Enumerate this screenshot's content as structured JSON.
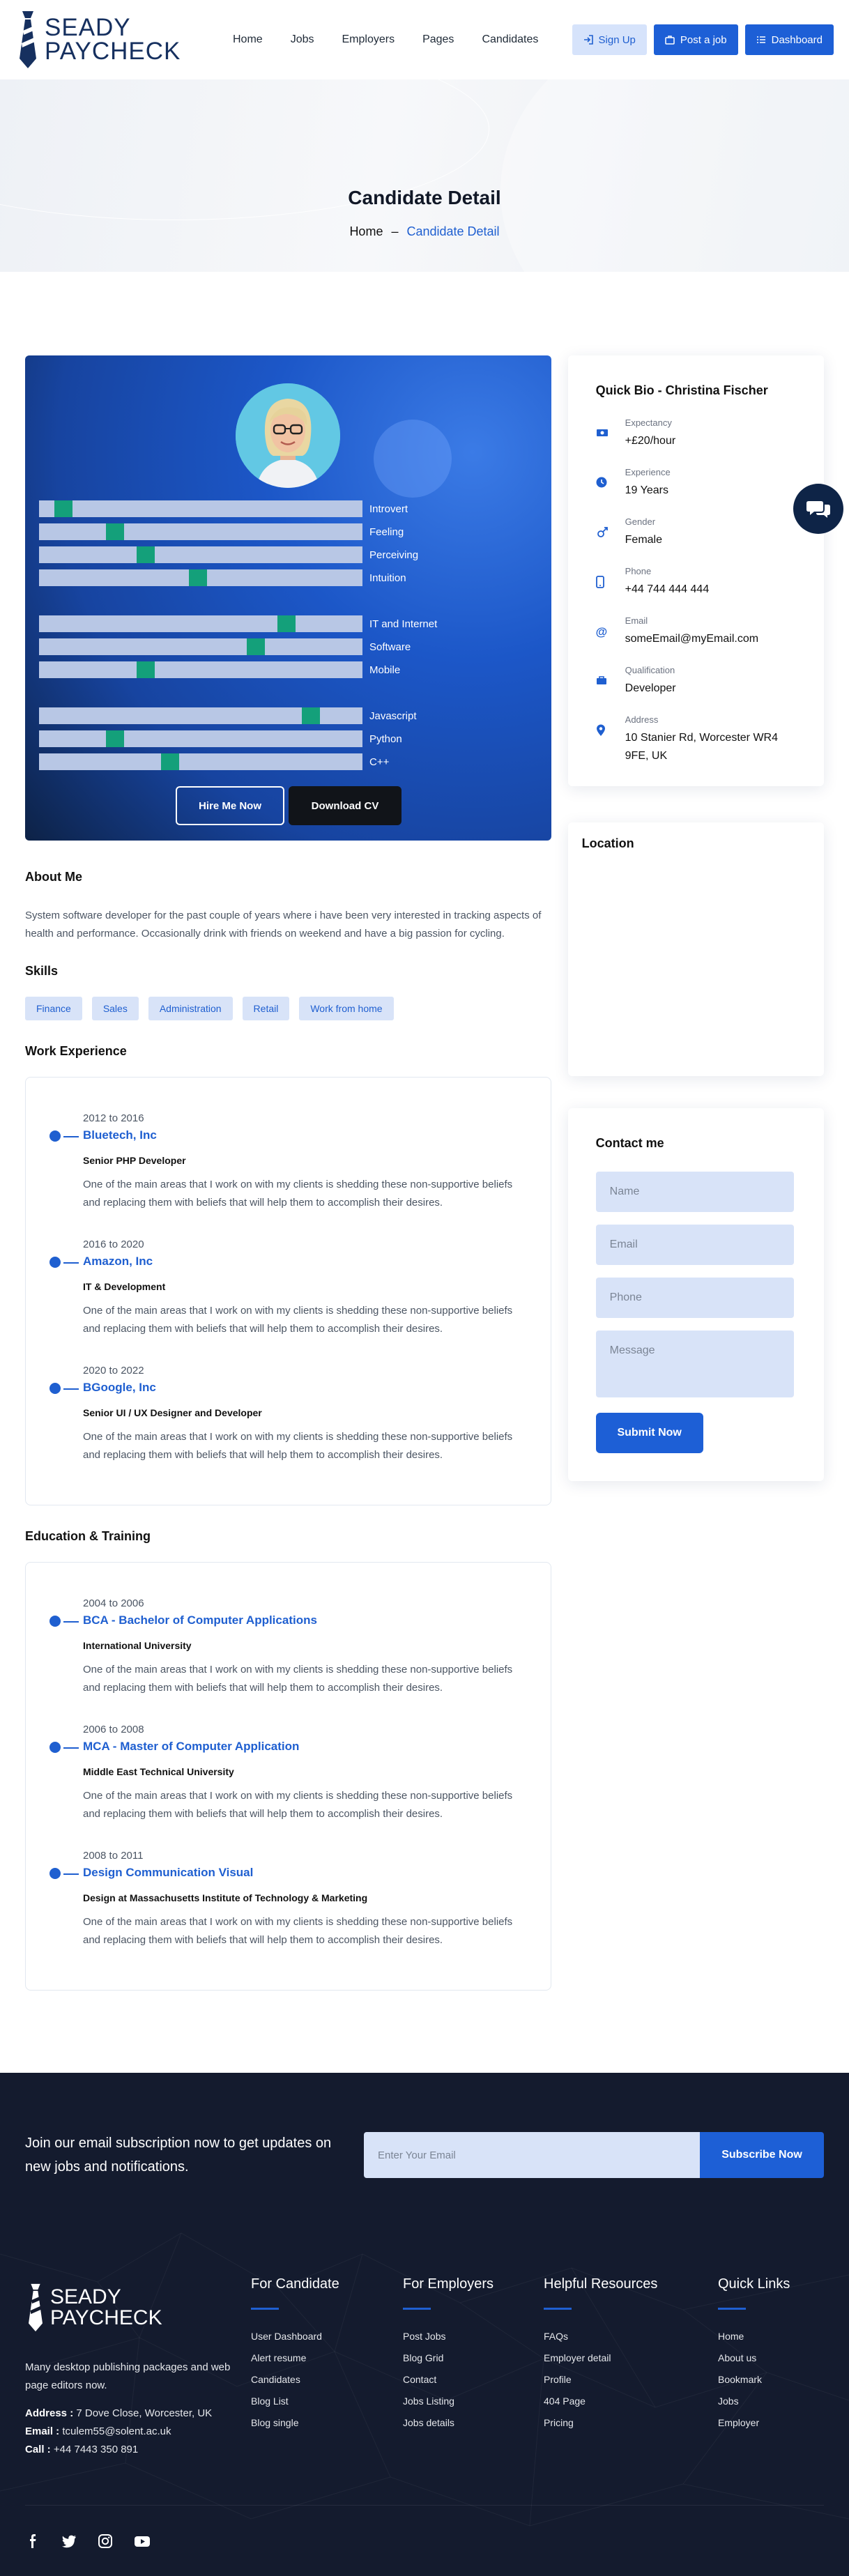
{
  "brand": {
    "logo_line1": "SEADY",
    "logo_line2": "PAYCHECK"
  },
  "nav": {
    "items": [
      "Home",
      "Jobs",
      "Employers",
      "Pages",
      "Candidates"
    ]
  },
  "header_actions": {
    "signup": "Sign Up",
    "post_job": "Post a job",
    "dashboard": "Dashboard"
  },
  "hero": {
    "title": "Candidate Detail",
    "crumb_home": "Home",
    "crumb_sep": "–",
    "crumb_current": "Candidate Detail"
  },
  "profile": {
    "bars": [
      {
        "label": "Introvert",
        "level": 0.05
      },
      {
        "label": "Feeling",
        "level": 0.22
      },
      {
        "label": "Perceiving",
        "level": 0.32
      },
      {
        "label": "Intuition",
        "level": 0.49
      },
      {
        "label": "IT and Internet",
        "level": 0.78
      },
      {
        "label": "Software",
        "level": 0.68
      },
      {
        "label": "Mobile",
        "level": 0.32
      },
      {
        "label": "Javascript",
        "level": 0.86
      },
      {
        "label": "Python",
        "level": 0.22
      },
      {
        "label": "C++",
        "level": 0.4
      }
    ],
    "hire_label": "Hire Me Now",
    "cv_label": "Download CV"
  },
  "about": {
    "title": "About Me",
    "text": "System software developer for the past couple of years where i have been very interested in tracking aspects of health and performance. Occasionally drink with friends on weekend and have a big passion for cycling."
  },
  "skills": {
    "title": "Skills",
    "items": [
      "Finance",
      "Sales",
      "Administration",
      "Retail",
      "Work from home"
    ]
  },
  "experience": {
    "title": "Work Experience",
    "items": [
      {
        "date": "2012 to 2016",
        "title": "Bluetech, Inc",
        "sub": "Senior PHP Developer",
        "desc": "One of the main areas that I work on with my clients is shedding these non-supportive beliefs and replacing them with beliefs that will help them to accomplish their desires."
      },
      {
        "date": "2016 to 2020",
        "title": "Amazon, Inc",
        "sub": "IT & Development",
        "desc": "One of the main areas that I work on with my clients is shedding these non-supportive beliefs and replacing them with beliefs that will help them to accomplish their desires."
      },
      {
        "date": "2020 to 2022",
        "title": "BGoogle, Inc",
        "sub": "Senior UI / UX Designer and Developer",
        "desc": "One of the main areas that I work on with my clients is shedding these non-supportive beliefs and replacing them with beliefs that will help them to accomplish their desires."
      }
    ]
  },
  "education": {
    "title": "Education & Training",
    "items": [
      {
        "date": "2004 to 2006",
        "title": "BCA - Bachelor of Computer Applications",
        "sub": "International University",
        "desc": "One of the main areas that I work on with my clients is shedding these non-supportive beliefs and replacing them with beliefs that will help them to accomplish their desires."
      },
      {
        "date": "2006 to 2008",
        "title": "MCA - Master of Computer Application",
        "sub": "Middle East Technical University",
        "desc": "One of the main areas that I work on with my clients is shedding these non-supportive beliefs and replacing them with beliefs that will help them to accomplish their desires."
      },
      {
        "date": "2008 to 2011",
        "title": "Design Communication Visual",
        "sub": "Design at Massachusetts Institute of Technology & Marketing",
        "desc": "One of the main areas that I work on with my clients is shedding these non-supportive beliefs and replacing them with beliefs that will help them to accomplish their desires."
      }
    ]
  },
  "bio": {
    "title": "Quick Bio - Christina Fischer",
    "items": [
      {
        "icon": "money-icon",
        "label": "Expectancy",
        "value": "+£20/hour"
      },
      {
        "icon": "clock-icon",
        "label": "Experience",
        "value": "19 Years"
      },
      {
        "icon": "gender-icon",
        "label": "Gender",
        "value": "Female"
      },
      {
        "icon": "phone-icon",
        "label": "Phone",
        "value": "+44 744 444 444"
      },
      {
        "icon": "at-icon",
        "label": "Email",
        "value": "someEmail@myEmail.com"
      },
      {
        "icon": "briefcase-icon",
        "label": "Qualification",
        "value": "Developer"
      },
      {
        "icon": "map-pin-icon",
        "label": "Address",
        "value": "10 Stanier Rd, Worcester WR4 9FE, UK"
      }
    ]
  },
  "location": {
    "title": "Location"
  },
  "contact": {
    "title": "Contact me",
    "name_placeholder": "Name",
    "email_placeholder": "Email",
    "phone_placeholder": "Phone",
    "message_placeholder": "Message",
    "submit": "Submit Now"
  },
  "newsletter": {
    "text": "Join our email subscription now to get updates on new jobs and notifications.",
    "placeholder": "Enter Your Email",
    "button": "Subscribe Now"
  },
  "footer": {
    "desc": "Many desktop publishing packages and web page editors now.",
    "address_label": "Address :",
    "address": "7 Dove Close, Worcester, UK",
    "email_label": "Email :",
    "email": "tculem55@solent.ac.uk",
    "call_label": "Call :",
    "call": "+44 7443 350 891",
    "cols": [
      {
        "title": "For Candidate",
        "links": [
          "User Dashboard",
          "Alert resume",
          "Candidates",
          "Blog List",
          "Blog single"
        ]
      },
      {
        "title": "For Employers",
        "links": [
          "Post Jobs",
          "Blog Grid",
          "Contact",
          "Jobs Listing",
          "Jobs details"
        ]
      },
      {
        "title": "Helpful Resources",
        "links": [
          "FAQs",
          "Employer detail",
          "Profile",
          "404 Page",
          "Pricing"
        ]
      },
      {
        "title": "Quick Links",
        "links": [
          "Home",
          "About us",
          "Bookmark",
          "Jobs",
          "Employer"
        ]
      }
    ],
    "social": [
      "facebook-icon",
      "twitter-icon",
      "instagram-icon",
      "youtube-icon"
    ]
  },
  "colors": {
    "primary": "#1d5fd6",
    "footer_bg": "#141b2e",
    "bar_mark": "#14a07a",
    "light_fill": "#d8e3f8"
  }
}
